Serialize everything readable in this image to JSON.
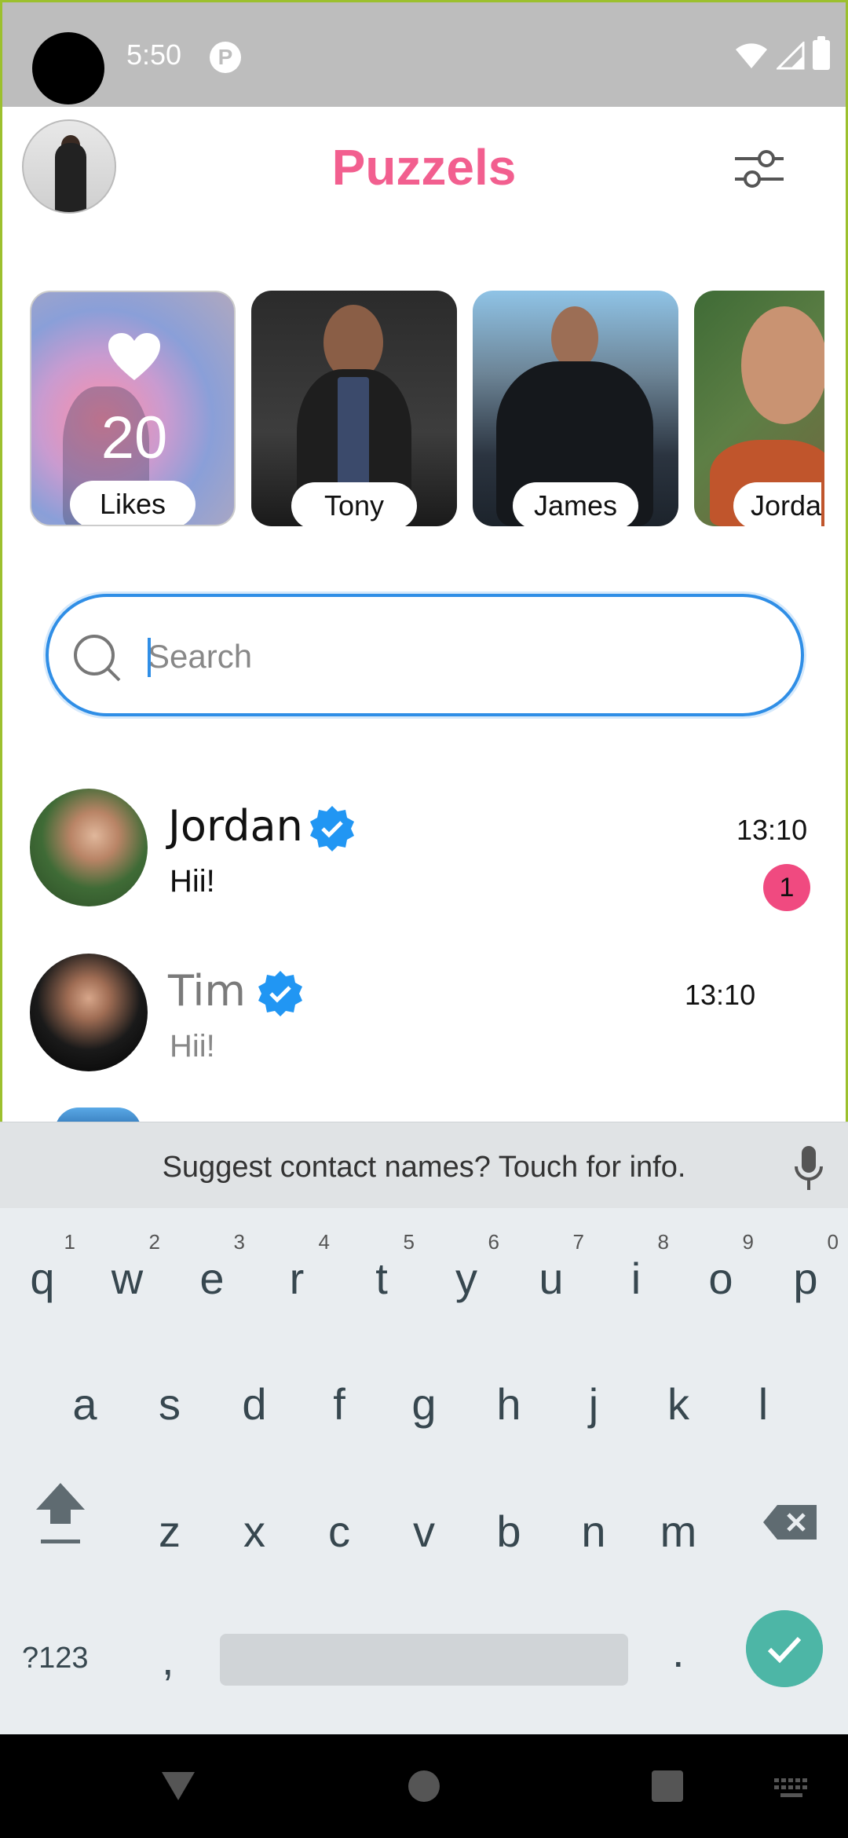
{
  "status_bar": {
    "time": "5:50",
    "notification_glyph": "P"
  },
  "header": {
    "title": "Puzzels",
    "filter_icon": "sliders-icon",
    "avatar_icon": "profile-avatar"
  },
  "stories": [
    {
      "type": "likes",
      "count": "20",
      "label": "Likes"
    },
    {
      "type": "user",
      "label": "Tony"
    },
    {
      "type": "user",
      "label": "James"
    },
    {
      "type": "user",
      "label": "Jorda"
    }
  ],
  "search": {
    "placeholder": "Search",
    "value": ""
  },
  "chats": [
    {
      "name": "Jordan",
      "message": "Hii!",
      "time": "13:10",
      "unread": "1",
      "verified": true
    },
    {
      "name": "Tim",
      "message": "Hii!",
      "time": "13:10",
      "verified": true
    }
  ],
  "keyboard": {
    "suggestion": "Suggest contact names? Touch for info.",
    "row1": [
      "q",
      "w",
      "e",
      "r",
      "t",
      "y",
      "u",
      "i",
      "o",
      "p"
    ],
    "row1_hints": [
      "1",
      "2",
      "3",
      "4",
      "5",
      "6",
      "7",
      "8",
      "9",
      "0"
    ],
    "row2": [
      "a",
      "s",
      "d",
      "f",
      "g",
      "h",
      "j",
      "k",
      "l"
    ],
    "row3": [
      "z",
      "x",
      "c",
      "v",
      "b",
      "n",
      "m"
    ],
    "symbols_label": "?123",
    "comma": ",",
    "period": "."
  },
  "colors": {
    "accent_pink": "#f25f8f",
    "search_blue": "#2f8ee6",
    "badge_pink": "#f04a80",
    "verified_blue": "#2196f3",
    "enter_teal": "#4db6a6"
  }
}
